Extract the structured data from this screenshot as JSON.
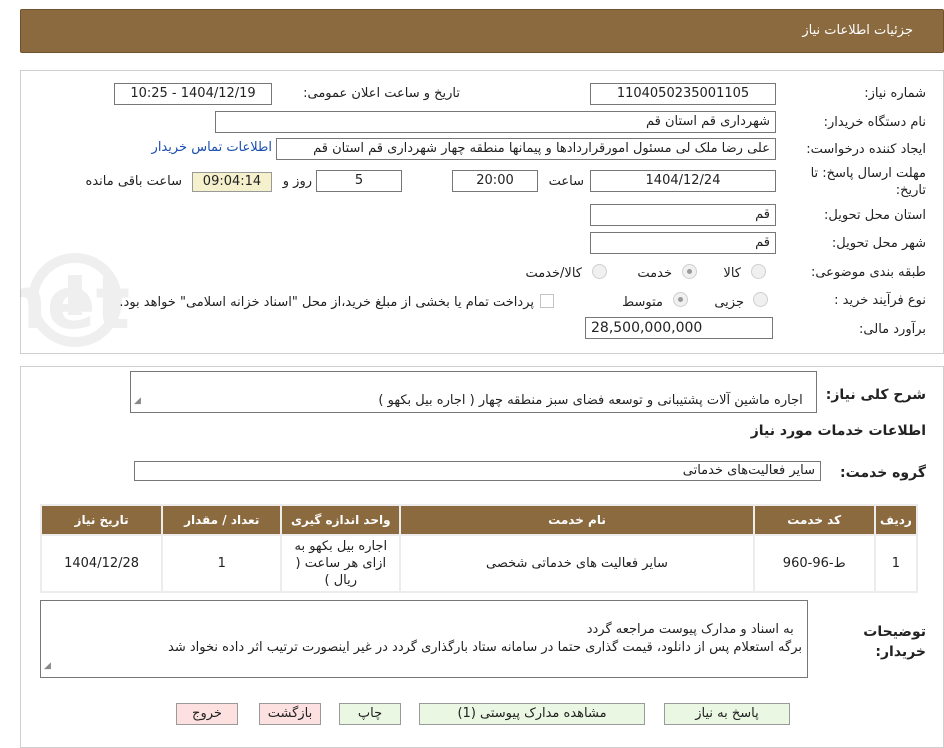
{
  "header": {
    "title": "جزئیات اطلاعات نیاز"
  },
  "form": {
    "need_number_label": "شماره نیاز:",
    "need_number": "1104050235001105",
    "announce_label": "تاریخ و ساعت اعلان عمومی:",
    "announce_value": "1404/12/19 - 10:25",
    "buyer_org_label": "نام دستگاه خریدار:",
    "buyer_org": "شهرداری قم استان قم",
    "requester_label": "ایجاد کننده درخواست:",
    "requester": "علی رضا ملک لی مسئول امورقراردادها و پیمانها منطقه چهار  شهرداری قم استان قم",
    "contact_link": "اطلاعات تماس خریدار",
    "deadline_label": "مهلت ارسال پاسخ: تا تاریخ:",
    "deadline_date": "1404/12/24",
    "time_label": "ساعت",
    "deadline_time": "20:00",
    "days_value": "5",
    "days_label": "روز و",
    "remaining_time": "09:04:14",
    "remaining_label": "ساعت باقی مانده",
    "province_label": "استان محل تحویل:",
    "province": "قم",
    "city_label": "شهر محل تحویل:",
    "city": "قم",
    "category_label": "طبقه بندی موضوعی:",
    "category_options": [
      "کالا",
      "خدمت",
      "کالا/خدمت"
    ],
    "category_selected": "خدمت",
    "process_label": "نوع فرآیند خرید :",
    "process_options": [
      "جزیی",
      "متوسط"
    ],
    "process_selected": "متوسط",
    "payment_note": "پرداخت تمام یا بخشی از مبلغ خرید،از محل \"اسناد خزانه اسلامی\" خواهد بود.",
    "budget_label": "برآورد مالی:",
    "budget": "28,500,000,000"
  },
  "description": {
    "label": "شرح کلی نیاز:",
    "text": "اجاره ماشین آلات پشتیبانی و توسعه فضای سبز منطقه چهار ( اجاره بیل بکهو )"
  },
  "services_section": {
    "title": "اطلاعات خدمات مورد نیاز",
    "group_label": "گروه خدمت:",
    "group_value": "سایر فعالیت‌های خدماتی"
  },
  "table": {
    "headers": [
      "ردیف",
      "کد خدمت",
      "نام خدمت",
      "واحد اندازه گیری",
      "تعداد / مقدار",
      "تاریخ نیاز"
    ],
    "rows": [
      [
        "1",
        "ط-96-960",
        "سایر فعالیت های خدماتی شخصی",
        "اجاره بیل بکهو به ازای هر ساعت ( ریال )",
        "1",
        "1404/12/28"
      ]
    ]
  },
  "buyer_notes": {
    "label": "توضیحات خریدار:",
    "text": "به اسناد و مدارک پیوست مراجعه گردد\nبرگه استعلام پس از دانلود، قیمت گذاری حتما در سامانه ستاد بارگذاری گردد در غیر اینصورت ترتیب اثر داده نخواد شد"
  },
  "buttons": {
    "reply": "پاسخ به نیاز",
    "attachments": "مشاهده مدارک پیوستی (1)",
    "print": "چاپ",
    "back": "بازگشت",
    "exit": "خروج"
  },
  "watermark": {
    "text": "AriaTender.net"
  },
  "colors": {
    "header_bg": "#8b6a40",
    "button_green": "#eaf7e3",
    "button_red": "#fde0e0",
    "time_highlight": "#f5f1cc",
    "link": "#1a4fb0"
  }
}
